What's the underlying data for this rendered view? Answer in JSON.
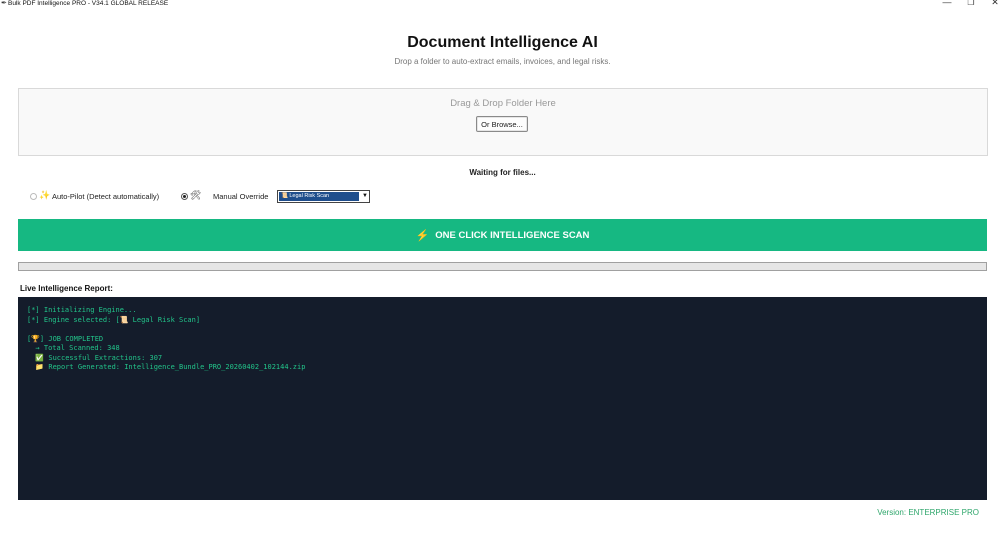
{
  "window": {
    "title": "Bulk PDF Intelligence PRO - V34.1 GLOBAL RELEASE",
    "app_icon": "feather-icon",
    "controls": {
      "minimize": "—",
      "maximize": "❐",
      "close": "✕"
    }
  },
  "header": {
    "title": "Document Intelligence AI",
    "subtitle": "Drop a folder to auto-extract emails, invoices, and legal risks."
  },
  "dropzone": {
    "label": "Drag & Drop Folder Here",
    "browse_label": "Or Browse..."
  },
  "status": {
    "text": "Waiting for files..."
  },
  "mode": {
    "auto_label": "Auto-Pilot (Detect automatically)",
    "auto_icon": "sparkles-icon",
    "auto_selected": false,
    "manual_label": "Manual Override",
    "manual_icon": "tools-icon",
    "manual_selected": true,
    "selected_option": "📜 Legal Risk Scan"
  },
  "scan_button": {
    "label": "ONE CLICK INTELLIGENCE SCAN",
    "icon": "lightning-icon"
  },
  "progress": {
    "value": 0
  },
  "log": {
    "title": "Live Intelligence Report:",
    "lines": [
      "[*] Initializing Engine...",
      "[*] Engine selected: [📜 Legal Risk Scan]",
      "",
      "[🏆] JOB COMPLETED",
      "  → Total Scanned: 348",
      "  ✅ Successful Extractions: 307",
      "  📁 Report Generated: Intelligence_Bundle_PRO_20260402_102144.zip"
    ]
  },
  "footer": {
    "version": "Version: ENTERPRISE PRO"
  },
  "colors": {
    "accent": "#16b882",
    "log_bg": "#141c2b",
    "log_text": "#22c48a",
    "select_highlight": "#1f4e8c"
  }
}
